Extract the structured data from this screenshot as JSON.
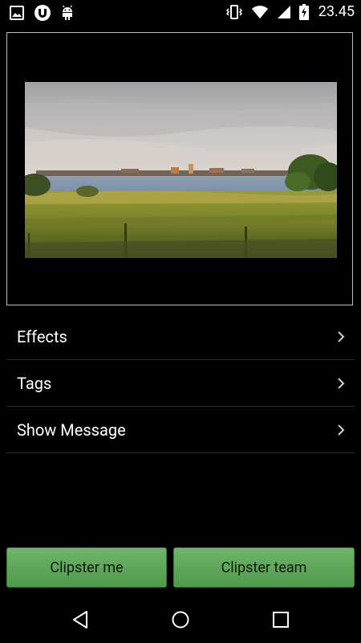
{
  "status_bar": {
    "time": "23.45",
    "left_icons": [
      "image-icon",
      "torrent-icon",
      "android-debug-icon"
    ],
    "right_icons": [
      "vibrate-icon",
      "wifi-icon",
      "signal-icon",
      "battery-charging-icon"
    ]
  },
  "preview": {
    "description_icon": "landscape-photo"
  },
  "menu": {
    "items": [
      {
        "label": "Effects"
      },
      {
        "label": "Tags"
      },
      {
        "label": "Show Message"
      }
    ]
  },
  "buttons": {
    "clipster_me": "Clipster me",
    "clipster_team": "Clipster team"
  },
  "nav": {
    "icons": [
      "back-icon",
      "home-icon",
      "recents-icon"
    ]
  },
  "colors": {
    "button_green": "#5aa456",
    "background": "#000000",
    "divider": "#2b2b2b"
  }
}
